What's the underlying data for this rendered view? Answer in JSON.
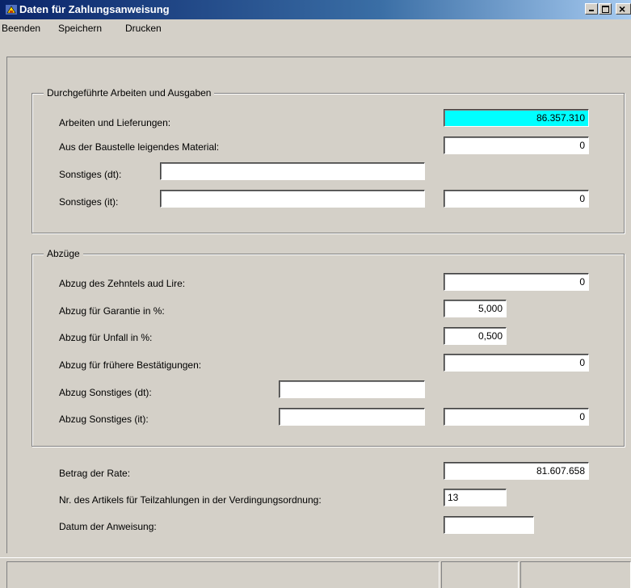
{
  "window": {
    "title": "Daten für Zahlungsanweisung",
    "controls": {
      "minimize": "_",
      "maximize": "□",
      "close": "×"
    }
  },
  "menu": [
    "Beenden",
    "Speichern",
    "Drucken"
  ],
  "sections": {
    "arbeiten": {
      "legend": "Durchgeführte Arbeiten und Ausgaben",
      "arbeiten_label": "Arbeiten und Lieferungen:",
      "arbeiten_value": "86.357.310",
      "material_label": "Aus der Baustelle leigendes Material:",
      "material_value": "0",
      "sonstiges_dt_label": "Sonstiges (dt):",
      "sonstiges_dt_value": "",
      "sonstiges_it_label": "Sonstiges (it):",
      "sonstiges_it_text": "",
      "sonstiges_it_value": "0"
    },
    "abzuege": {
      "legend": "Abzüge",
      "zehntel_label": "Abzug des Zehntels aud Lire:",
      "zehntel_value": "0",
      "garantie_label": "Abzug für Garantie in %:",
      "garantie_value": "5,000",
      "unfall_label": "Abzug für Unfall in %:",
      "unfall_value": "0,500",
      "frueher_label": "Abzug für frühere Bestätigungen:",
      "frueher_value": "0",
      "sonst_dt_label": "Abzug Sonstiges (dt):",
      "sonst_dt_value": "",
      "sonst_it_label": "Abzug Sonstiges (it):",
      "sonst_it_text": "",
      "sonst_it_value": "0"
    },
    "summary": {
      "betrag_label": "Betrag der Rate:",
      "betrag_value": "81.607.658",
      "artikel_label": "Nr. des Artikels für Teilzahlungen in der Verdingungsordnung:",
      "artikel_value": "13",
      "datum_label": "Datum der Anweisung:",
      "datum_value": ""
    }
  },
  "colors": {
    "highlight_field": "#00ffff",
    "title_bar": "#0a246a",
    "face": "#d4d0c8"
  },
  "icons": {
    "app": "app-icon",
    "minimize": "minimize-icon",
    "maximize": "maximize-icon",
    "close": "close-icon"
  }
}
